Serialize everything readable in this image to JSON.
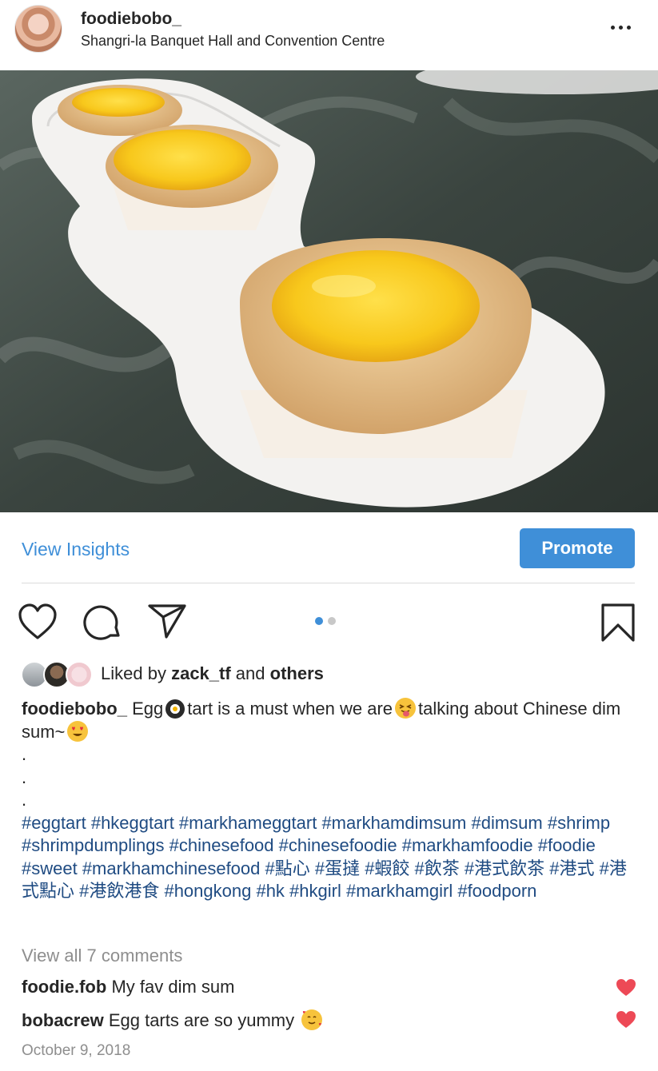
{
  "post": {
    "username": "foodiebobo_",
    "location": "Shangri-la Banquet Hall and Convention Centre",
    "more_icon": "more-horizontal-icon",
    "image_alt": "Egg tarts on a white dish"
  },
  "insights": {
    "view_label": "View Insights",
    "promote_label": "Promote"
  },
  "actions": {
    "icons": [
      "heart-icon",
      "comment-icon",
      "share-icon",
      "save-icon"
    ],
    "carousel_count": 2,
    "carousel_active": 1
  },
  "likes": {
    "prefix": "Liked by",
    "user": "zack_tf",
    "joiner": "and",
    "others": "others"
  },
  "caption": {
    "author": "foodiebobo_",
    "text_1": "Egg",
    "text_2": "tart is a must when we are",
    "text_3": "talking about Chinese dim sum~",
    "dots": [
      ".",
      ".",
      "."
    ],
    "hashtags": "#eggtart #hkeggtart #markhameggtart #markhamdimsum #dimsum #shrimp #shrimpdumplings #chinesefood #chinesefoodie #markhamfoodie #foodie #sweet #markhamchinesefood #點心 #蛋撻 #蝦餃 #飲茶 #港式飲茶 #港式 #港式點心 #港飲港食 #hongkong #hk #hkgirl #markhamgirl #foodporn"
  },
  "comments": {
    "view_all": "View all 7 comments",
    "items": [
      {
        "user": "foodie.fob",
        "text": "My fav dim sum"
      },
      {
        "user": "bobacrew",
        "text": "Egg tarts are so yummy"
      }
    ]
  },
  "timestamp": "October 9, 2018",
  "colors": {
    "accent": "#3f8fd8",
    "hashtag": "#1f4b82",
    "like_red": "#ed4956",
    "muted": "#8e8e8e"
  }
}
